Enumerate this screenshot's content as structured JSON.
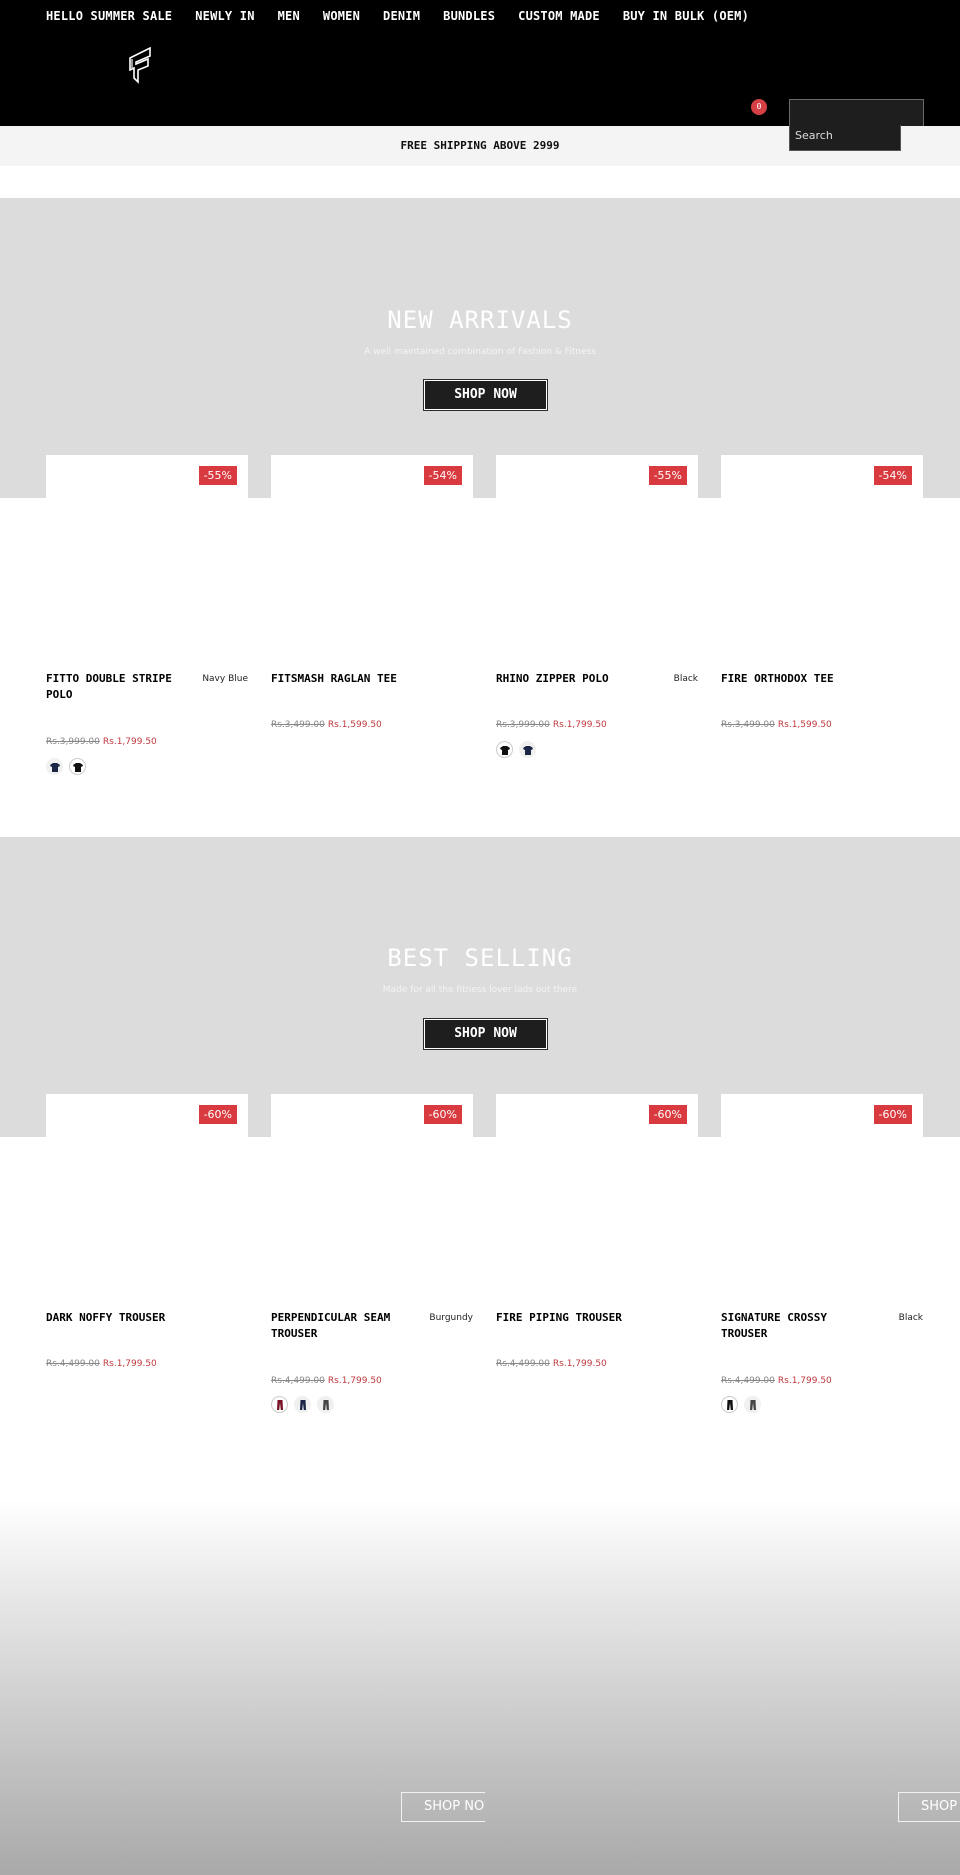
{
  "header": {
    "nav": [
      "HELLO SUMMER SALE",
      "NEWLY IN",
      "MEN",
      "WOMEN",
      "DENIM",
      "BUNDLES",
      "CUSTOM MADE",
      "BUY IN BULK (OEM)"
    ],
    "cart_count": "0",
    "search_placeholder": "Search"
  },
  "shipping_bar": "FREE SHIPPING ABOVE 2999",
  "sections": [
    {
      "title": "NEW ARRIVALS",
      "subtitle": "A well maintained combination of Fashion & Fitness",
      "button": "SHOP NOW",
      "products": [
        {
          "discount": "-55%",
          "name": "FITTO DOUBLE STRIPE POLO",
          "color": "Navy Blue",
          "old_price": "Rs.3,999.00",
          "price": "Rs.1,799.50",
          "swatches": [
            "#1b2545",
            "#111111"
          ]
        },
        {
          "discount": "-54%",
          "name": "FITSMASH RAGLAN TEE",
          "color": "",
          "old_price": "Rs.3,499.00",
          "price": "Rs.1,599.50",
          "swatches": []
        },
        {
          "discount": "-55%",
          "name": "RHINO ZIPPER POLO",
          "color": "Black",
          "old_price": "Rs.3,999.00",
          "price": "Rs.1,799.50",
          "swatches": [
            "#111111",
            "#1b2545"
          ]
        },
        {
          "discount": "-54%",
          "name": "FIRE ORTHODOX TEE",
          "color": "",
          "old_price": "Rs.3,499.00",
          "price": "Rs.1,599.50",
          "swatches": []
        }
      ]
    },
    {
      "title": "BEST SELLING",
      "subtitle": "Made for all the fitness lover lads out there",
      "button": "SHOP NOW",
      "products": [
        {
          "discount": "-60%",
          "name": "DARK NOFFY TROUSER",
          "color": "",
          "old_price": "Rs.4,499.00",
          "price": "Rs.1,799.50",
          "swatches": []
        },
        {
          "discount": "-60%",
          "name": "PERPENDICULAR SEAM TROUSER",
          "color": "Burgundy",
          "old_price": "Rs.4,499.00",
          "price": "Rs.1,799.50",
          "swatches": [
            "#7a1426",
            "#1b2545",
            "#444444"
          ]
        },
        {
          "discount": "-60%",
          "name": "FIRE PIPING TROUSER",
          "color": "",
          "old_price": "Rs.4,499.00",
          "price": "Rs.1,799.50",
          "swatches": []
        },
        {
          "discount": "-60%",
          "name": "SIGNATURE CROSSY TROUSER",
          "color": "Black",
          "old_price": "Rs.4,499.00",
          "price": "Rs.1,799.50",
          "swatches": [
            "#111111",
            "#444444"
          ]
        }
      ]
    }
  ],
  "banner": {
    "buttons": [
      "SHOP NOW",
      "SHOP NOW"
    ]
  }
}
